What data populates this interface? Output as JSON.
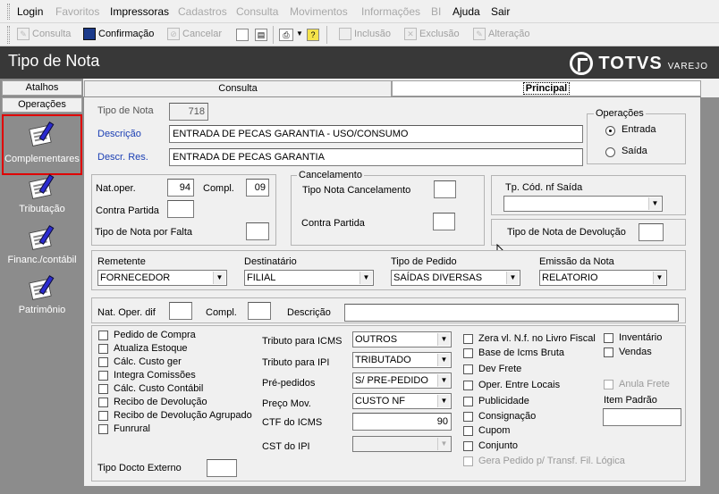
{
  "menu": {
    "items": [
      {
        "label": "Login",
        "enabled": true
      },
      {
        "label": "Favoritos",
        "enabled": false
      },
      {
        "label": "Impressoras",
        "enabled": true
      },
      {
        "label": "Cadastros",
        "enabled": false
      },
      {
        "label": "Consulta",
        "enabled": false
      },
      {
        "label": "Movimentos",
        "enabled": false
      },
      {
        "label": "Informações",
        "enabled": false
      },
      {
        "label": "BI",
        "enabled": false
      },
      {
        "label": "Ajuda",
        "enabled": true
      },
      {
        "label": "Sair",
        "enabled": true
      }
    ]
  },
  "toolbar": {
    "consulta": "Consulta",
    "confirmacao": "Confirmação",
    "cancelar": "Cancelar",
    "inclusao": "Inclusão",
    "exclusao": "Exclusão",
    "alteracao": "Alteração"
  },
  "window": {
    "title": "Tipo de Nota"
  },
  "logo": {
    "brand": "TOTVS",
    "sub": "VAREJO"
  },
  "sidebar": {
    "tabs": [
      "Atalhos",
      "Operações"
    ],
    "items": [
      {
        "label": "Complementares",
        "selected": true
      },
      {
        "label": "Tributação",
        "selected": false
      },
      {
        "label": "Financ./contábil",
        "selected": false
      },
      {
        "label": "Patrimônio",
        "selected": false
      }
    ]
  },
  "tabs": {
    "consulta": "Consulta",
    "principal": "Principal"
  },
  "form": {
    "tipo_nota_label": "Tipo de Nota",
    "tipo_nota_value": "718",
    "descricao_label": "Descrição",
    "descricao_value": "ENTRADA DE PECAS GARANTIA - USO/CONSUMO",
    "descr_res_label": "Descr. Res.",
    "descr_res_value": "ENTRADA DE PECAS GARANTIA",
    "operacoes_title": "Operações",
    "entrada_label": "Entrada",
    "saida_label": "Saída",
    "nat_oper_label": "Nat.oper.",
    "nat_oper_value": "94",
    "compl_label": "Compl.",
    "compl_value": "09",
    "contra_partida_label": "Contra Partida",
    "tipo_nota_falta_label": "Tipo de Nota por Falta",
    "cancelamento_title": "Cancelamento",
    "tipo_nota_cancel_label": "Tipo Nota Cancelamento",
    "contra_partida2_label": "Contra Partida",
    "tp_cod_nf_saida_label": "Tp. Cód. nf Saída",
    "tipo_nota_devolucao_label": "Tipo de Nota de Devolução",
    "remetente_label": "Remetente",
    "remetente_value": "FORNECEDOR",
    "destinatario_label": "Destinatário",
    "destinatario_value": "FILIAL",
    "tipo_pedido_label": "Tipo de Pedido",
    "tipo_pedido_value": "SAÍDAS DIVERSAS",
    "emissao_nota_label": "Emissão da Nota",
    "emissao_nota_value": "RELATORIO",
    "nat_oper_dif_label": "Nat. Oper. dif",
    "compl2_label": "Compl.",
    "descricao2_label": "Descrição",
    "checks_left": [
      "Pedido de Compra",
      "Atualiza Estoque",
      "Cálc. Custo ger",
      "Integra Comissões",
      "Cálc. Custo Contábil",
      "Recibo de Devolução",
      "Recibo de Devolução Agrupado",
      "Funrural"
    ],
    "tributo_icms_label": "Tributo para ICMS",
    "tributo_icms_value": "OUTROS",
    "tributo_ipi_label": "Tributo para IPI",
    "tributo_ipi_value": "TRIBUTADO",
    "pre_pedidos_label": "Pré-pedidos",
    "pre_pedidos_value": "S/ PRE-PEDIDO",
    "preco_mov_label": "Preço Mov.",
    "preco_mov_value": "CUSTO NF",
    "ctf_icms_label": "CTF do ICMS",
    "ctf_icms_value": "90",
    "cst_ipi_label": "CST do IPI",
    "checks_mid": [
      "Zera vl. N.f. no Livro Fiscal",
      "Base de Icms Bruta",
      "Dev Frete",
      "Oper. Entre Locais",
      "Publicidade",
      "Consignação",
      "Cupom",
      "Conjunto"
    ],
    "gera_pedido_label": "Gera Pedido p/ Transf. Fil. Lógica",
    "inventario_label": "Inventário",
    "vendas_label": "Vendas",
    "anula_frete_label": "Anula Frete",
    "item_padrao_label": "Item Padrão",
    "tipo_docto_externo_label": "Tipo Docto Externo"
  }
}
